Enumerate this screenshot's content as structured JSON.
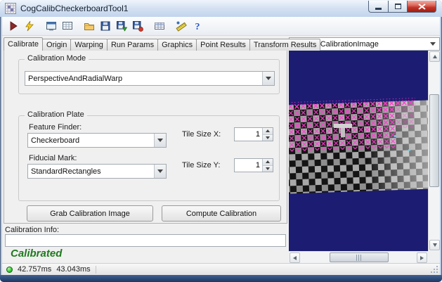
{
  "window": {
    "title": "CogCalibCheckerboardTool1"
  },
  "toolbar": {
    "icons": [
      "run",
      "electric-run",
      "image-display",
      "record-display",
      "open-file",
      "save",
      "save-image",
      "save-results",
      "edit-grid",
      "calibration-ruler",
      "help"
    ]
  },
  "tabs": [
    "Calibrate",
    "Origin",
    "Warping",
    "Run Params",
    "Graphics",
    "Point Results",
    "Transform Results"
  ],
  "calibrate": {
    "mode_group_label": "Calibration Mode",
    "mode_value": "PerspectiveAndRadialWarp",
    "plate_group_label": "Calibration Plate",
    "feature_finder_label": "Feature Finder:",
    "feature_finder_value": "Checkerboard",
    "fiducial_label": "Fiducial Mark:",
    "fiducial_value": "StandardRectangles",
    "tile_x_label": "Tile Size X:",
    "tile_x_value": "1",
    "tile_y_label": "Tile Size Y:",
    "tile_y_value": "1",
    "grab_button": "Grab Calibration Image",
    "compute_button": "Compute Calibration"
  },
  "info": {
    "label": "Calibration Info:",
    "value": "",
    "status": "Calibrated"
  },
  "status_bar": {
    "time1": "42.757ms",
    "time2": "43.043ms"
  },
  "image_panel": {
    "view_selector": "Current.CalibrationImage"
  },
  "colors": {
    "status_green": "#1f7a1f",
    "marker_magenta": "#ff3cd2",
    "image_bg": "#1c1c72",
    "close_red": "#c23428"
  }
}
